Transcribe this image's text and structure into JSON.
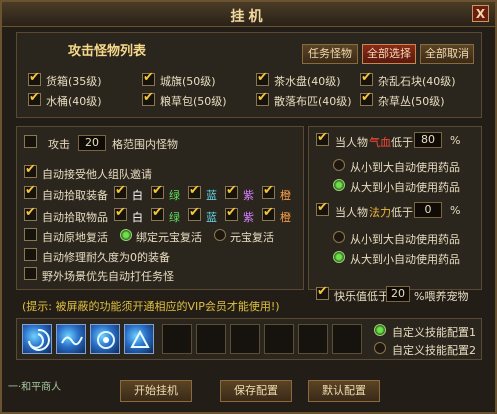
{
  "window": {
    "title": "挂机",
    "close_label": "X"
  },
  "monster_list": {
    "title": "攻击怪物列表",
    "buttons": {
      "task": "任务怪物",
      "select_all": "全部选择",
      "cancel_all": "全部取消"
    },
    "items": [
      {
        "label": "货箱(35级)",
        "checked": true
      },
      {
        "label": "城旗(50级)",
        "checked": true
      },
      {
        "label": "茶水盘(40级)",
        "checked": true
      },
      {
        "label": "杂乱石块(40级)",
        "checked": true
      },
      {
        "label": "水桶(40级)",
        "checked": true
      },
      {
        "label": "粮草包(50级)",
        "checked": true
      },
      {
        "label": "散落布匹(40级)",
        "checked": true
      },
      {
        "label": "杂草丛(50级)",
        "checked": true
      }
    ]
  },
  "left_options": {
    "attack_prefix": "攻击",
    "attack_range": "20",
    "attack_suffix": "格范围内怪物",
    "accept_invite": "自动接受他人组队邀请",
    "auto_equip": "自动拾取装备",
    "auto_item": "自动拾取物品",
    "qualities": [
      "白",
      "绿",
      "蓝",
      "紫",
      "橙"
    ],
    "revive_here": "自动原地复活",
    "bind_yuanbao_revive": "绑定元宝复活",
    "yuanbao_revive": "元宝复活",
    "repair_zero": "自动修理耐久度为0的装备",
    "field_task": "野外场景优先自动打任务怪"
  },
  "right_options": {
    "hp_prefix": "当人物",
    "hp_stat": "气血",
    "hp_suffix": "低于",
    "hp_value": "80",
    "percent": "%",
    "hp_small_to_big": "从小到大自动使用药品",
    "hp_big_to_small": "从大到小自动使用药品",
    "mp_prefix": "当人物",
    "mp_stat": "法力",
    "mp_suffix": "低于",
    "mp_value": "0",
    "mp_small_to_big": "从小到大自动使用药品",
    "mp_big_to_small": "从大到小自动使用药品",
    "happy_prefix": "快乐值低于",
    "happy_value": "20",
    "happy_suffix": "%喂养宠物"
  },
  "tip": "(提示: 被屏蔽的功能须开通相应的VIP会员才能使用!)",
  "skills": {
    "config1": "自定义技能配置1",
    "config2": "自定义技能配置2",
    "icons": [
      "water-swirl-skill-icon",
      "wave-skill-icon",
      "vortex-skill-icon",
      "storm-skill-icon"
    ]
  },
  "footer": {
    "start": "开始挂机",
    "save": "保存配置",
    "default": "默认配置",
    "background_text": "一·和平商人"
  }
}
